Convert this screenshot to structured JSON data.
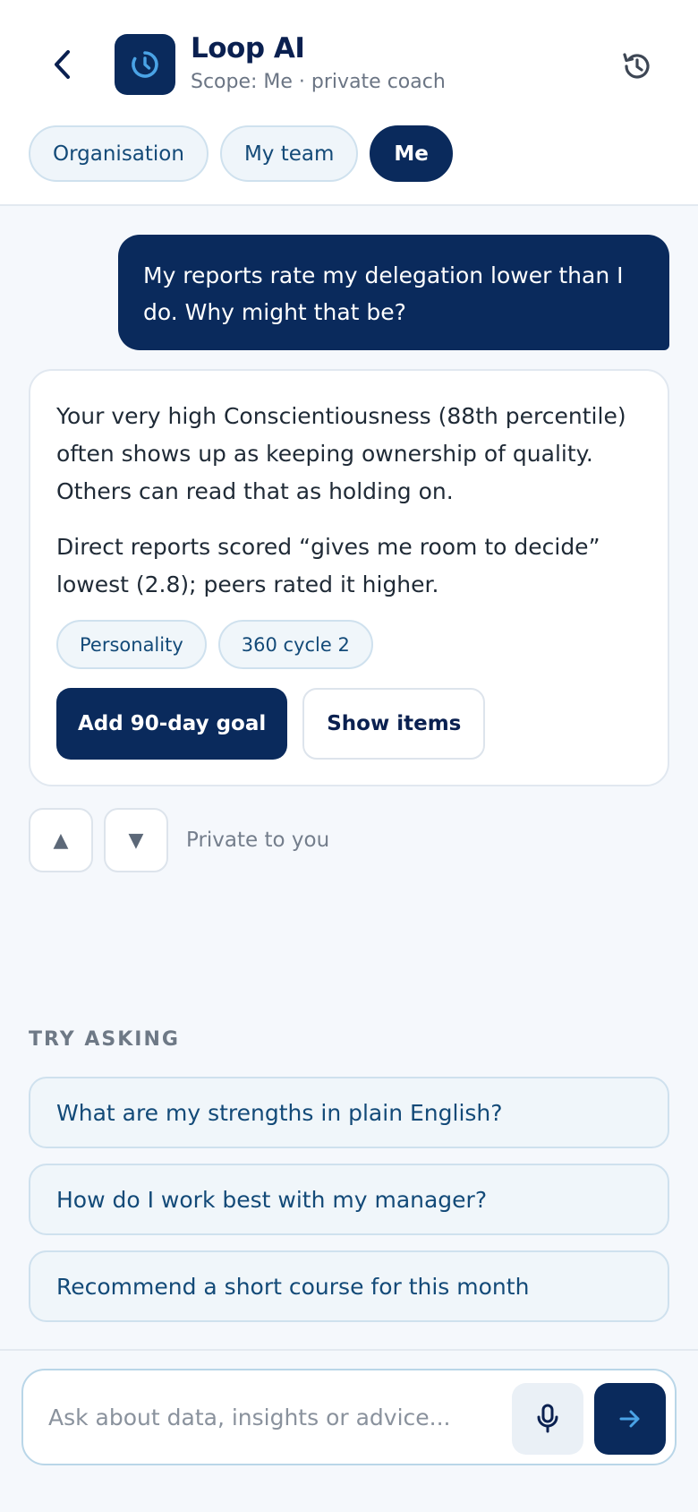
{
  "header": {
    "title": "Loop AI",
    "subtitle": "Scope: Me · private coach",
    "icons": {
      "back": "chevron-left-icon",
      "logo": "loop-clock-icon",
      "history": "history-icon"
    }
  },
  "scope_tabs": [
    {
      "label": "Organisation",
      "active": false
    },
    {
      "label": "My team",
      "active": false
    },
    {
      "label": "Me",
      "active": true
    }
  ],
  "conversation": {
    "user_message": "My reports rate my delegation lower than I do. Why might that be?",
    "ai_response": {
      "paragraphs": [
        "Your very high Conscientiousness (88th percentile) often shows up as keeping ownership of quality. Others can read that as holding on.",
        "Direct reports scored “gives me room to decide” lowest (2.8); peers rated it higher."
      ],
      "sources": [
        "Personality",
        "360 cycle 2"
      ],
      "actions": {
        "primary": "Add 90-day goal",
        "secondary": "Show items"
      }
    },
    "feedback": {
      "upvote_glyph": "▲",
      "downvote_glyph": "▼",
      "privacy_note": "Private to you"
    }
  },
  "try_asking": {
    "label": "TRY ASKING",
    "suggestions": [
      "What are my strengths in plain English?",
      "How do I work best with my manager?",
      "Recommend a short course for this month"
    ]
  },
  "composer": {
    "placeholder": "Ask about data, insights or advice...",
    "value": "",
    "icons": {
      "mic": "microphone-icon",
      "send": "arrow-right-icon"
    }
  },
  "colors": {
    "brand_navy": "#0a2a5c",
    "accent_blue": "#4aa3e6",
    "chip_text": "#134a78",
    "background": "#f5f8fc"
  }
}
